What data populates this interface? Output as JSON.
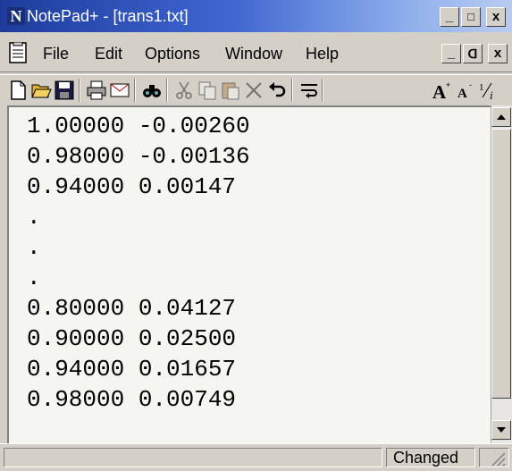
{
  "window": {
    "title": "NotePad+ - [trans1.txt]",
    "app_icon_letter": "N",
    "caption_buttons": [
      "_",
      "□",
      "x"
    ]
  },
  "menubar": {
    "items": [
      "File",
      "Edit",
      "Options",
      "Window",
      "Help"
    ],
    "doc_buttons": [
      "_",
      "ᗡ",
      "x"
    ]
  },
  "toolbar": {
    "buttons": [
      "new-file",
      "open-folder",
      "save",
      "print",
      "email",
      "find",
      "cut",
      "copy",
      "paste",
      "delete",
      "undo",
      "wrap",
      "font-larger",
      "font-smaller",
      "fraction"
    ]
  },
  "editor": {
    "lines": [
      "1.00000 -0.00260",
      "0.98000 -0.00136",
      "0.94000 0.00147",
      ".",
      ".",
      ".",
      "0.80000 0.04127",
      "0.90000 0.02500",
      "0.94000 0.01657",
      "0.98000 0.00749"
    ]
  },
  "statusbar": {
    "state": "Changed"
  },
  "colors": {
    "titlebar_start": "#1d3c9c",
    "titlebar_end": "#b9ccef",
    "chrome": "#d4d0c8",
    "editor_bg": "#f6f6f0"
  }
}
